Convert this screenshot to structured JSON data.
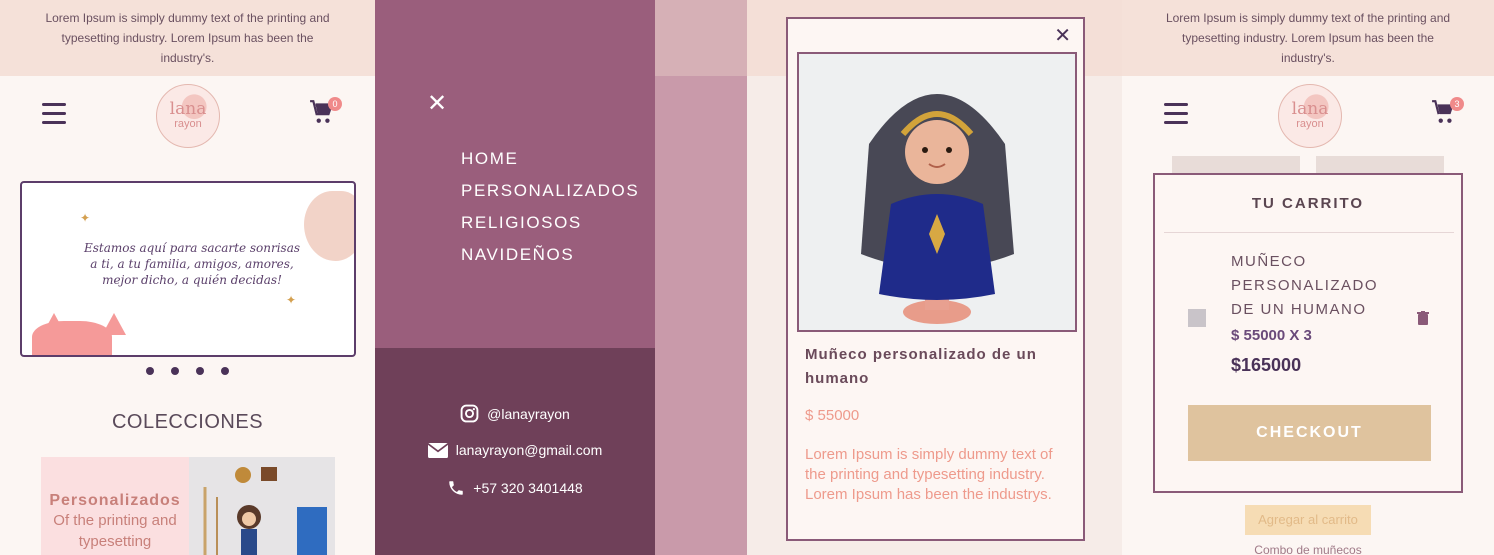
{
  "announcement": "Lorem Ipsum is simply dummy text of the printing and typesetting industry. Lorem Ipsum has been the industry's.",
  "logo": {
    "line1": "lana",
    "line2": "rayon"
  },
  "cart_count_home": "0",
  "cart_count_cart": "3",
  "hero_message": "Estamos aquí para sacarte sonrisas a ti, a tu familia, amigos, amores, mejor dicho, a quién decidas!",
  "collections_title": "COLECCIONES",
  "collection_card": {
    "title": "Personalizados",
    "subtitle": "Of the printing and typesetting"
  },
  "menu": {
    "items": [
      "HOME",
      "PERSONALIZADOS",
      "RELIGIOSOS",
      "NAVIDEÑOS"
    ],
    "instagram": "@lanayrayon",
    "email": "lanayrayon@gmail.com",
    "phone": "+57 320 3401448"
  },
  "product": {
    "title": "Muñeco personalizado de un humano",
    "price": "$ 55000",
    "description": "Lorem Ipsum is simply dummy text of the printing and typesetting industry. Lorem Ipsum has been the industrys."
  },
  "cart": {
    "title": "TU CARRITO",
    "item_name": "MUÑECO PERSONALIZADO DE UN HUMANO",
    "item_qty": "$ 55000 X 3",
    "item_total": "$165000",
    "checkout": "CHECKOUT",
    "bg_add_label": "Agregar al carrito",
    "bg_combo_label": "Combo de muñecos"
  },
  "colors": {
    "plum": "#4a3258",
    "menu": "#9a5e7c",
    "accent": "#ee9a8c",
    "checkout": "#dfc39e"
  }
}
